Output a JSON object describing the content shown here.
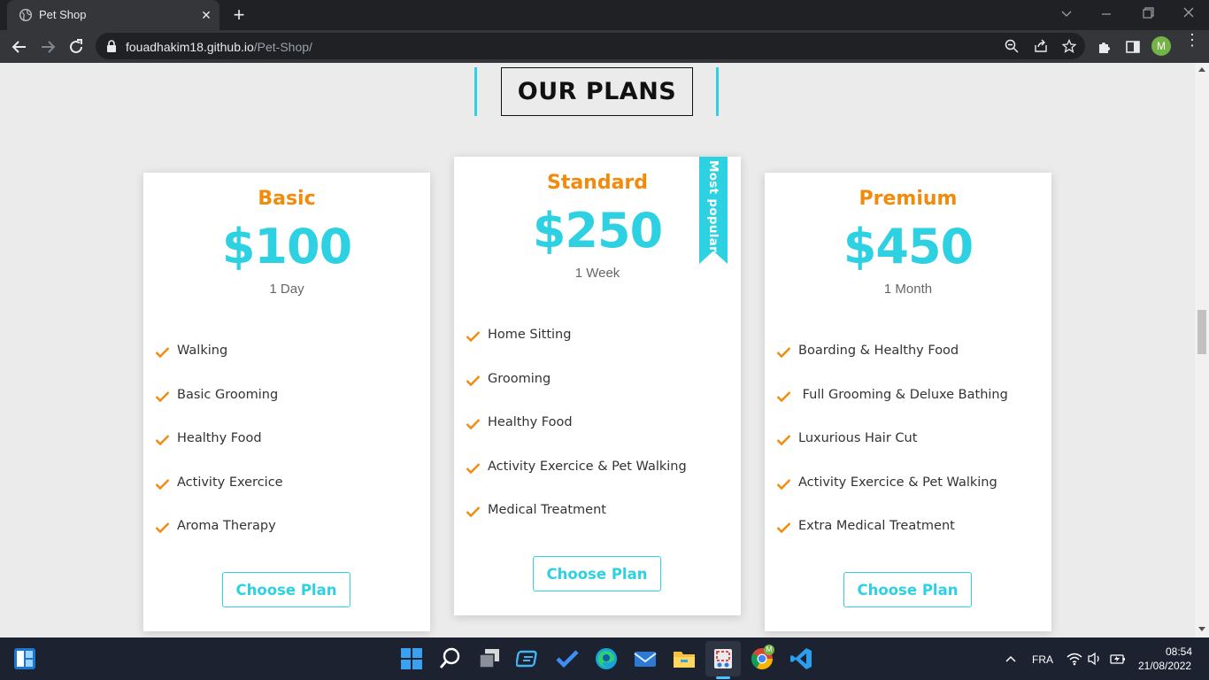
{
  "browser": {
    "tab_title": "Pet Shop",
    "tab_close": "✕",
    "new_tab": "+",
    "url_host": "fouadhakim18.github.io",
    "url_path": "/Pet-Shop/",
    "profile_initial": "M",
    "menu": "⋮"
  },
  "page": {
    "heading": "OUR PLANS",
    "accent_color": "#2ed1e1",
    "title_color": "#f28b0c",
    "plans": [
      {
        "name": "Basic",
        "price": "$100",
        "period": "1 Day",
        "features": [
          "Walking",
          "Basic Grooming",
          "Healthy Food",
          "Activity Exercice",
          "Aroma Therapy"
        ],
        "button": "Choose Plan"
      },
      {
        "name": "Standard",
        "price": "$250",
        "period": "1 Week",
        "badge": "Most popular",
        "features": [
          "Home Sitting",
          "Grooming",
          "Healthy Food",
          "Activity Exercice & Pet Walking",
          "Medical Treatment"
        ],
        "button": "Choose Plan"
      },
      {
        "name": "Premium",
        "price": "$450",
        "period": "1 Month",
        "features": [
          "Boarding & Healthy Food",
          " Full Grooming & Deluxe Bathing",
          "Luxurious Hair Cut",
          "Activity Exercice & Pet Walking",
          "Extra Medical Treatment"
        ],
        "button": "Choose Plan"
      }
    ]
  },
  "taskbar": {
    "language": "FRA",
    "time": "08:54",
    "date": "21/08/2022",
    "chrome_badge": "M",
    "apps": [
      "start-icon",
      "search-icon",
      "task-view-icon",
      "widgets-icon",
      "todo-icon",
      "edge-icon",
      "mail-icon",
      "file-explorer-icon",
      "snipping-tool-icon",
      "chrome-icon",
      "vscode-icon"
    ]
  }
}
